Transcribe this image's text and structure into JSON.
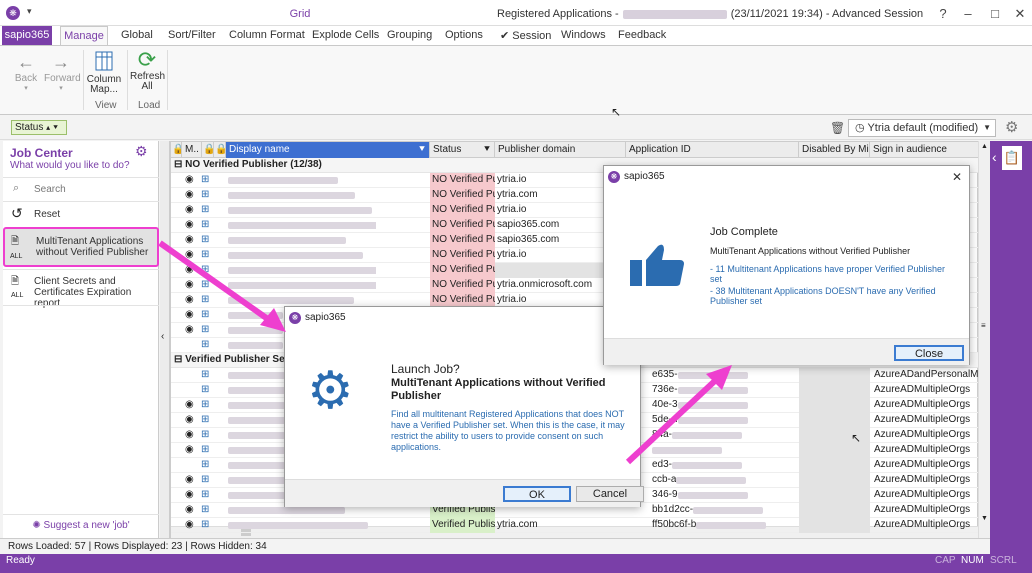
{
  "window": {
    "ribbon_group": "Grid",
    "title_prefix": "Registered Applications -",
    "title_suffix": "(23/11/2021 19:34) - Advanced Session"
  },
  "tabs": {
    "app": "sapio365",
    "items": [
      "Manage",
      "Global",
      "Sort/Filter",
      "Column Format",
      "Explode Cells",
      "Grouping",
      "Options",
      "Session",
      "Windows",
      "Feedback"
    ]
  },
  "ribbon": {
    "back": "Back",
    "forward": "Forward",
    "column_map": "Column Map...",
    "refresh": "Refresh All",
    "view": "View",
    "load": "Load"
  },
  "filter": {
    "chip": "Status",
    "view_select": "Ytria default (modified)"
  },
  "left": {
    "title": "Job Center",
    "subtitle": "What would you like to do?",
    "search": "Search",
    "reset": "Reset",
    "job1": "MultiTenant Applications without Verified Publisher",
    "job1_badge": "ALL",
    "job2": "Client Secrets and Certificates Expiration report",
    "job2_badge": "ALL",
    "suggest": "Suggest a new 'job'"
  },
  "grid": {
    "headers": [
      "M..",
      "Display name",
      "Status",
      "Publisher domain",
      "Application ID",
      "Disabled By Mi...",
      "Sign in audience"
    ],
    "group1": "NO Verified Publisher (12/38)",
    "group2": "Verified Publisher Set (1",
    "nvp_status": "NO Verified Pub",
    "vp_status": "Verified Publish",
    "g1_domains": [
      "ytria.io",
      "ytria.com",
      "ytria.io",
      "sapio365.com",
      "sapio365.com",
      "ytria.io",
      "",
      "ytria.onmicrosoft.com",
      "ytria.io"
    ],
    "g2_rows": [
      {
        "appid": "e635-",
        "aud": "AzureADandPersonalMicro"
      },
      {
        "appid": "736e-",
        "aud": "AzureADMultipleOrgs"
      },
      {
        "appid": "40e-3",
        "aud": "AzureADMultipleOrgs"
      },
      {
        "appid": "5de-d",
        "aud": "AzureADMultipleOrgs"
      },
      {
        "appid": "84a-",
        "aud": "AzureADMultipleOrgs"
      },
      {
        "appid": "",
        "aud": "AzureADMultipleOrgs"
      },
      {
        "appid": "ed3-",
        "aud": "AzureADMultipleOrgs"
      },
      {
        "appid": "ccb-a",
        "aud": "AzureADMultipleOrgs"
      },
      {
        "appid": "346-9",
        "aud": "AzureADMultipleOrgs"
      },
      {
        "appid": "bb1d2cc-",
        "aud": "AzureADMultipleOrgs"
      },
      {
        "appid": "ff50bc6f-b",
        "aud": "AzureADMultipleOrgs"
      }
    ],
    "last_domain": "ytria.com"
  },
  "status": {
    "rows": "Rows Loaded: 57  |  Rows Displayed: 23  |  Rows Hidden: 34",
    "ready": "Ready",
    "caps": [
      "CAP",
      "NUM",
      "SCRL"
    ]
  },
  "launch": {
    "app": "sapio365",
    "heading": "Launch Job?",
    "name": "MultiTenant Applications without Verified Publisher",
    "desc": "Find all multitenant Registered Applications that does NOT have a Verified Publisher set. When this is the case, it may restrict the ability to users to provide consent on such applications.",
    "ok": "OK",
    "cancel": "Cancel"
  },
  "complete": {
    "app": "sapio365",
    "heading": "Job Complete",
    "name": "MultiTenant Applications without Verified Publisher",
    "line1": "- 11 Multitenant Applications have proper Verified Publisher set",
    "line2": "- 38 Multitenant Applications DOESN'T have any Verified Publisher set",
    "close": "Close"
  },
  "colors": {
    "accent": "#7a3fa8",
    "arrow": "#ee3fcf",
    "nvp": "#f6c9cd",
    "vp": "#d9f0c9"
  }
}
